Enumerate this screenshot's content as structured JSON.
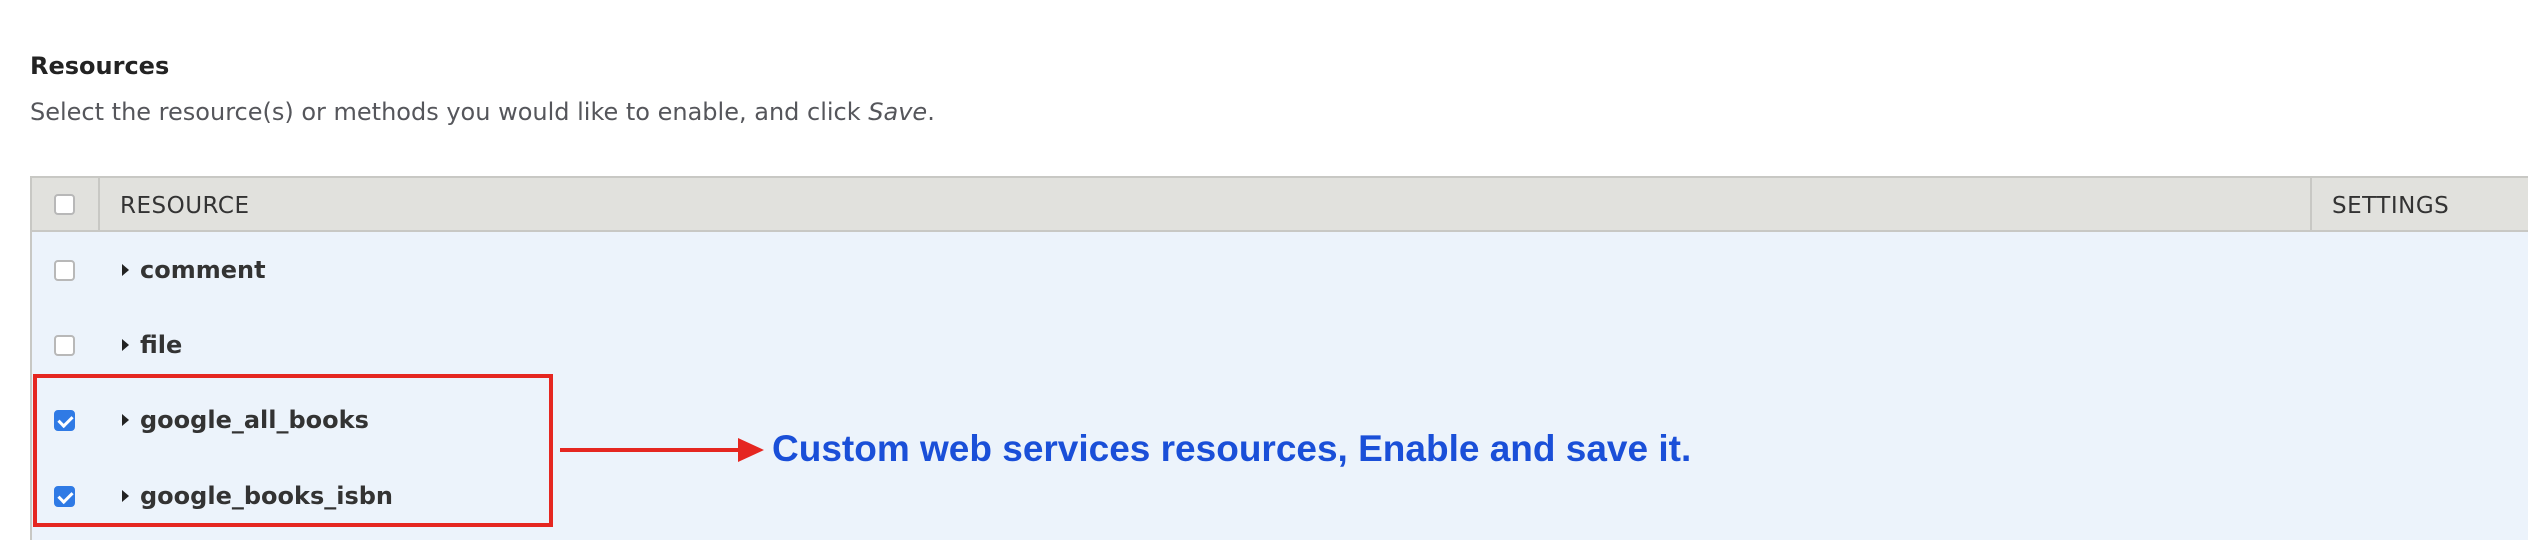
{
  "section": {
    "title": "Resources",
    "description_prefix": "Select the resource(s) or methods you would like to enable, and click ",
    "description_emphasis": "Save",
    "description_suffix": "."
  },
  "table": {
    "columns": [
      "RESOURCE",
      "SETTINGS"
    ],
    "rows": [
      {
        "label": "comment",
        "checked": false
      },
      {
        "label": "file",
        "checked": false
      },
      {
        "label": "google_all_books",
        "checked": true
      },
      {
        "label": "google_books_isbn",
        "checked": true
      }
    ]
  },
  "annotation": {
    "text": "Custom web services resources, Enable and save it.",
    "color": "#1a4fd8",
    "highlight_color": "#e52620"
  },
  "colors": {
    "checkbox_checked": "#2f7ae5",
    "table_body_bg": "#ecf3fb",
    "table_header_bg": "#e1e1dd"
  }
}
